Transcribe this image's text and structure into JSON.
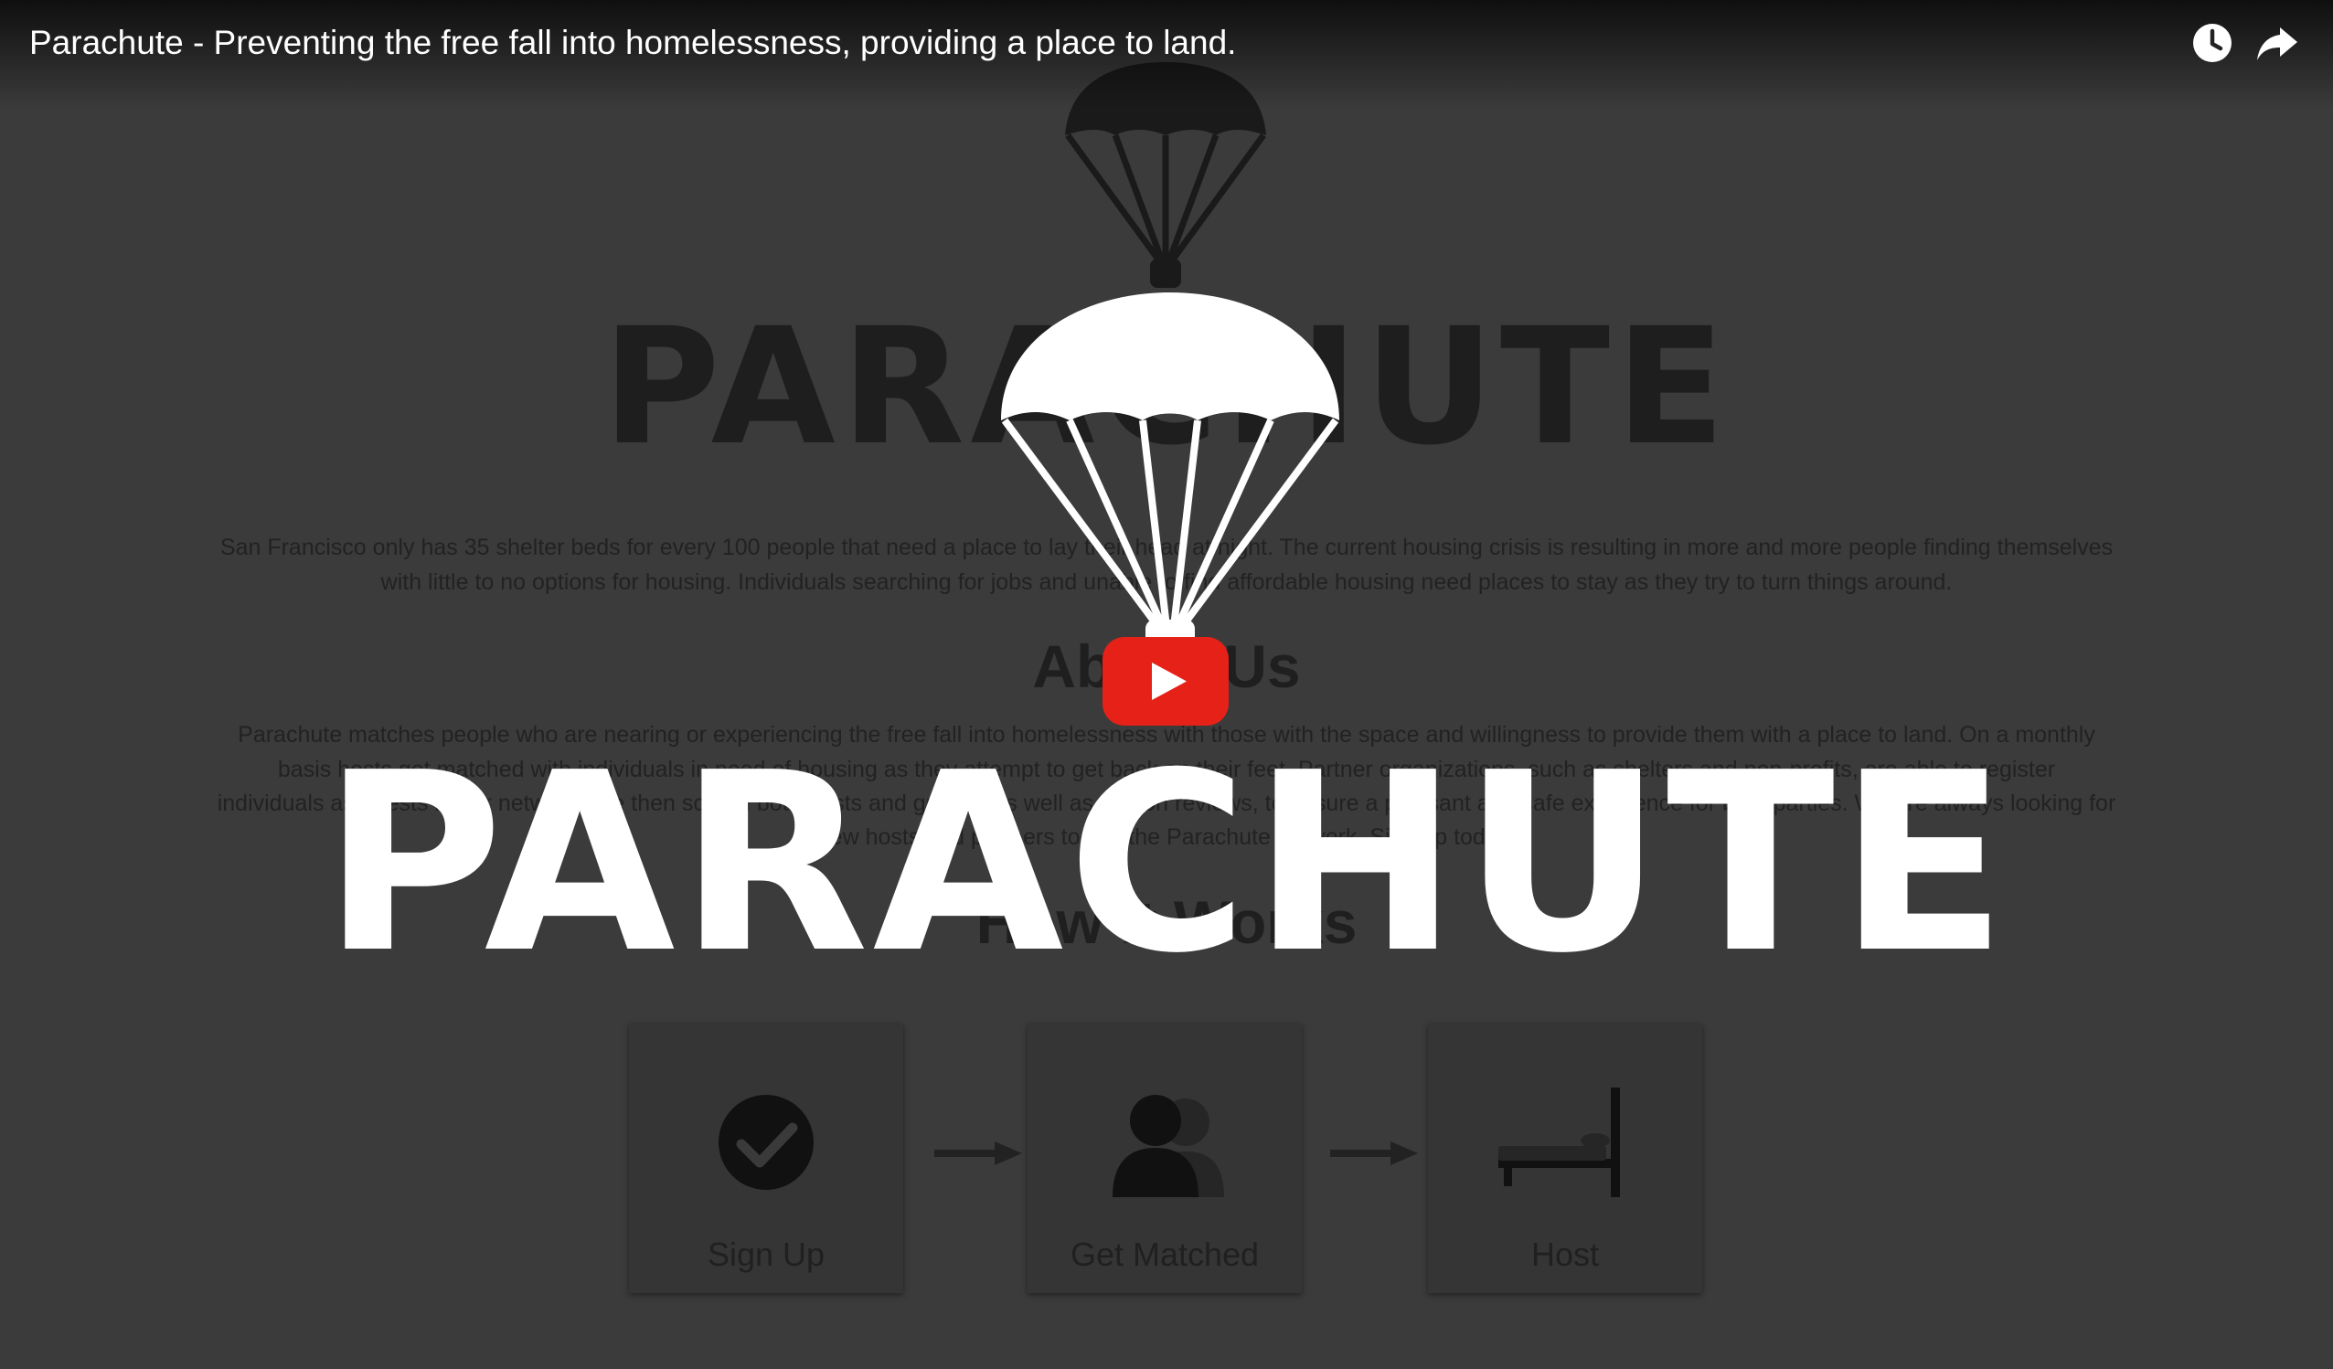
{
  "video": {
    "title": "Parachute - Preventing the free fall into homelessness, providing a place to land."
  },
  "controls": {
    "watch_later_icon": "clock-icon",
    "share_icon": "share-arrow-icon",
    "play_icon": "youtube-play-icon"
  },
  "thumbnail": {
    "logo_text": "PARACHUTE"
  },
  "background_page": {
    "logo_text": "PARACHUTE",
    "intro_lines": [
      "San Francisco only has 35 shelter beds for every 100 people that need a place to lay their head at night. The current housing crisis is resulting in more and more people finding themselves",
      "with little to no options for housing. Individuals searching for jobs and unable to find affordable housing need places to stay as they try to turn things around."
    ],
    "about_heading": "About Us",
    "about_lines": [
      "Parachute matches people who are nearing or experiencing the free fall into homelessness with those with the space and willingness to provide them with a place to land. On a monthly",
      "basis hosts get matched with individuals in need of housing as they attempt to get back on their feet. Partner organizations, such as shelters and non-profits, are able to register",
      "individuals as guests in our network. We then screen both hosts and guests, as well as rely on reviews, to assure a pleasant and safe experience for both parties. We are always looking for",
      "new hosts and partners to join the Parachute network. Sign up today!"
    ],
    "how_heading": "How It Works",
    "steps": [
      {
        "label": "Sign Up",
        "icon": "checkmark-circle-icon"
      },
      {
        "label": "Get Matched",
        "icon": "people-icon"
      },
      {
        "label": "Host",
        "icon": "bed-icon"
      }
    ]
  },
  "colors": {
    "play_button": "#e62117",
    "overlay_background": "#3b3b3b",
    "foreground_text": "#ffffff"
  }
}
